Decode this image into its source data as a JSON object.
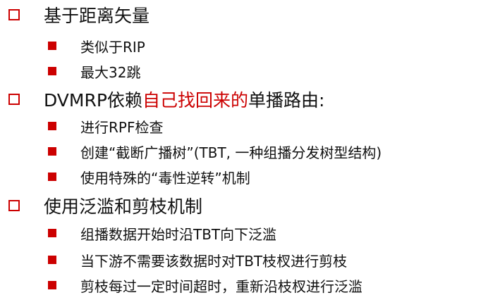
{
  "slide": {
    "items": [
      {
        "level": 1,
        "text": "基于距离矢量"
      },
      {
        "level": 2,
        "text": "类似于RIP"
      },
      {
        "level": 2,
        "text": "最大32跳"
      },
      {
        "level": 1,
        "text_before": "DVMRP依赖",
        "text_highlight": "自己找回来的",
        "text_after": "单播路由:"
      },
      {
        "level": 2,
        "text": "进行RPF检查"
      },
      {
        "level": 2,
        "text": "创建“截断广播树”(TBT, 一种组播分发树型结构)"
      },
      {
        "level": 2,
        "text": "使用特殊的“毒性逆转”机制"
      },
      {
        "level": 1,
        "text": "使用泛滥和剪枝机制"
      },
      {
        "level": 2,
        "text": "组播数据开始时沿TBT向下泛滥"
      },
      {
        "level": 2,
        "text": "当下游不需要该数据时对TBT枝杈进行剪枝"
      },
      {
        "level": 2,
        "text": "剪枝每过一定时间超时，重新沿枝杈进行泛滥"
      }
    ]
  },
  "colors": {
    "bullet": "#cc0000",
    "highlight": "#cc0000",
    "text": "#111111"
  },
  "icons": {
    "level1_bullet": "hollow-square-icon",
    "level2_bullet": "filled-square-icon"
  }
}
